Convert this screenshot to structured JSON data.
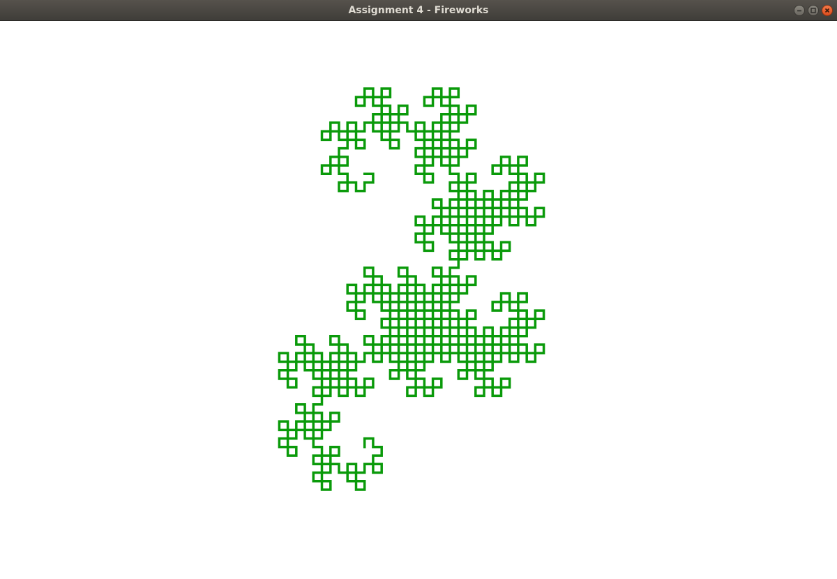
{
  "window": {
    "title": "Assignment 4 - Fireworks",
    "controls": {
      "minimize_icon": "minimize-icon",
      "maximize_icon": "maximize-icon",
      "close_icon": "close-icon"
    }
  },
  "canvas": {
    "background": "#ffffff",
    "stroke_color": "#0a9a0a",
    "fractal": "dragon-curve"
  }
}
